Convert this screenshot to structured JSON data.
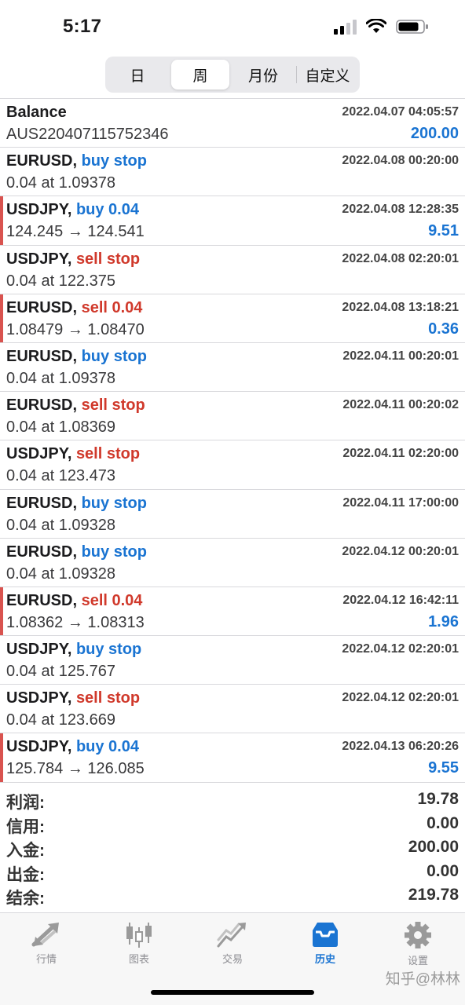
{
  "status": {
    "time": "5:17"
  },
  "period_tabs": [
    {
      "label": "日",
      "active": false
    },
    {
      "label": "周",
      "active": true
    },
    {
      "label": "月份",
      "active": false
    },
    {
      "label": "自定义",
      "active": false
    }
  ],
  "history": [
    {
      "symbol": "Balance",
      "action": "",
      "action_color": "",
      "detail": "AUS220407115752346",
      "time": "2022.04.07 04:05:57",
      "amount": "200.00",
      "marked": false
    },
    {
      "symbol": "EURUSD,",
      "action": "buy stop",
      "action_color": "blue",
      "detail": "0.04 at 1.09378",
      "time": "2022.04.08 00:20:00",
      "amount": "",
      "marked": false
    },
    {
      "symbol": "USDJPY,",
      "action": "buy 0.04",
      "action_color": "blue",
      "detail": "124.245 → 124.541",
      "time": "2022.04.08 12:28:35",
      "amount": "9.51",
      "marked": true
    },
    {
      "symbol": "USDJPY,",
      "action": "sell stop",
      "action_color": "red",
      "detail": "0.04 at 122.375",
      "time": "2022.04.08 02:20:01",
      "amount": "",
      "marked": false
    },
    {
      "symbol": "EURUSD,",
      "action": "sell 0.04",
      "action_color": "red",
      "detail": "1.08479 → 1.08470",
      "time": "2022.04.08 13:18:21",
      "amount": "0.36",
      "marked": true
    },
    {
      "symbol": "EURUSD,",
      "action": "buy stop",
      "action_color": "blue",
      "detail": "0.04 at 1.09378",
      "time": "2022.04.11 00:20:01",
      "amount": "",
      "marked": false
    },
    {
      "symbol": "EURUSD,",
      "action": "sell stop",
      "action_color": "red",
      "detail": "0.04 at 1.08369",
      "time": "2022.04.11 00:20:02",
      "amount": "",
      "marked": false
    },
    {
      "symbol": "USDJPY,",
      "action": "sell stop",
      "action_color": "red",
      "detail": "0.04 at 123.473",
      "time": "2022.04.11 02:20:00",
      "amount": "",
      "marked": false
    },
    {
      "symbol": "EURUSD,",
      "action": "buy stop",
      "action_color": "blue",
      "detail": "0.04 at 1.09328",
      "time": "2022.04.11 17:00:00",
      "amount": "",
      "marked": false
    },
    {
      "symbol": "EURUSD,",
      "action": "buy stop",
      "action_color": "blue",
      "detail": "0.04 at 1.09328",
      "time": "2022.04.12 00:20:01",
      "amount": "",
      "marked": false
    },
    {
      "symbol": "EURUSD,",
      "action": "sell 0.04",
      "action_color": "red",
      "detail": "1.08362 → 1.08313",
      "time": "2022.04.12 16:42:11",
      "amount": "1.96",
      "marked": true
    },
    {
      "symbol": "USDJPY,",
      "action": "buy stop",
      "action_color": "blue",
      "detail": "0.04 at 125.767",
      "time": "2022.04.12 02:20:01",
      "amount": "",
      "marked": false
    },
    {
      "symbol": "USDJPY,",
      "action": "sell stop",
      "action_color": "red",
      "detail": "0.04 at 123.669",
      "time": "2022.04.12 02:20:01",
      "amount": "",
      "marked": false
    },
    {
      "symbol": "USDJPY,",
      "action": "buy 0.04",
      "action_color": "blue",
      "detail": "125.784 → 126.085",
      "time": "2022.04.13 06:20:26",
      "amount": "9.55",
      "marked": true
    }
  ],
  "summary": [
    {
      "label": "利润:",
      "value": "19.78"
    },
    {
      "label": "信用:",
      "value": "0.00"
    },
    {
      "label": "入金:",
      "value": "200.00"
    },
    {
      "label": "出金:",
      "value": "0.00"
    },
    {
      "label": "结余:",
      "value": "219.78"
    }
  ],
  "tabbar": [
    {
      "label": "行情",
      "icon": "quotes-arrows-icon",
      "active": false
    },
    {
      "label": "图表",
      "icon": "candlestick-chart-icon",
      "active": false
    },
    {
      "label": "交易",
      "icon": "trade-trend-icon",
      "active": false
    },
    {
      "label": "历史",
      "icon": "history-inbox-icon",
      "active": true
    },
    {
      "label": "设置",
      "icon": "gear-icon",
      "active": false
    }
  ],
  "watermark": "知乎@林林",
  "colors": {
    "buy": "#1a74d2",
    "sell": "#d0392b",
    "profit": "#1a74d2",
    "marker": "#d9534f"
  }
}
